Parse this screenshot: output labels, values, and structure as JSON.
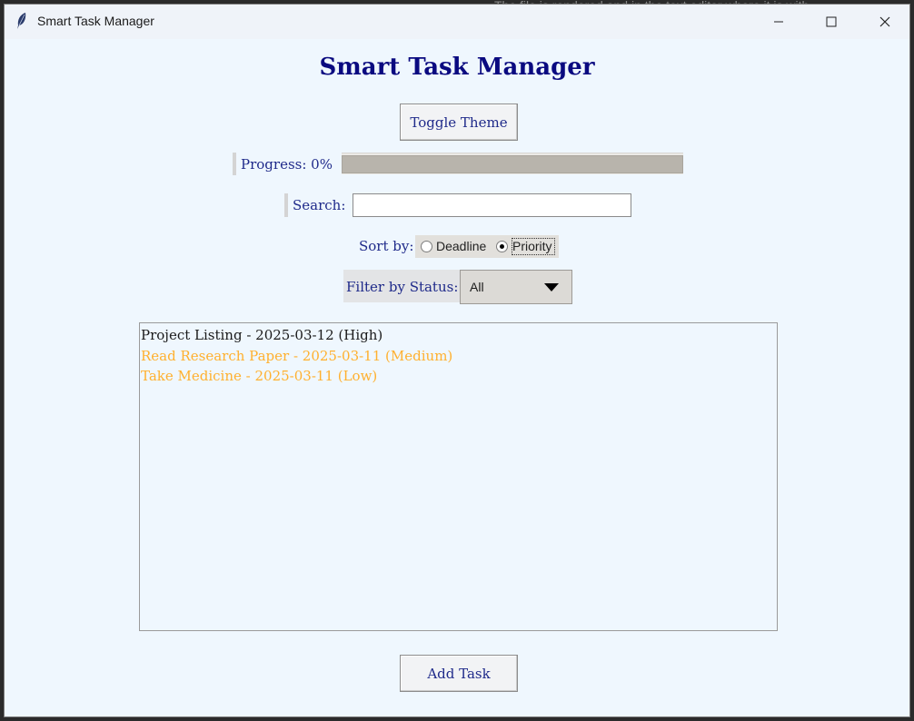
{
  "background_text": "The file is rendered and in the text editor where it is with",
  "window": {
    "title": "Smart Task Manager",
    "minimize_icon": "minimize-icon",
    "maximize_icon": "maximize-icon",
    "close_icon": "close-icon"
  },
  "app": {
    "heading": "Smart Task Manager",
    "toggle_theme_label": "Toggle Theme",
    "progress_label": "Progress: 0%",
    "progress_value": 0,
    "search_label": "Search:",
    "search_value": "",
    "sort_label": "Sort by:",
    "sort_options": [
      {
        "label": "Deadline",
        "selected": false
      },
      {
        "label": "Priority",
        "selected": true
      }
    ],
    "filter_label": "Filter by Status:",
    "filter_selected": "All",
    "tasks": [
      {
        "text": "Project Listing - 2025-03-12 (High)",
        "color": "#1a1a1a"
      },
      {
        "text": "Read Research Paper - 2025-03-11 (Medium)",
        "color": "#ffb02e"
      },
      {
        "text": "Take Medicine - 2025-03-11 (Low)",
        "color": "#ffb02e"
      }
    ],
    "add_task_label": "Add Task"
  },
  "colors": {
    "accent": "#0a0a80",
    "label": "#1f2a8a",
    "window_bg": "#eff7fe",
    "medium_low_priority": "#ffb02e"
  }
}
